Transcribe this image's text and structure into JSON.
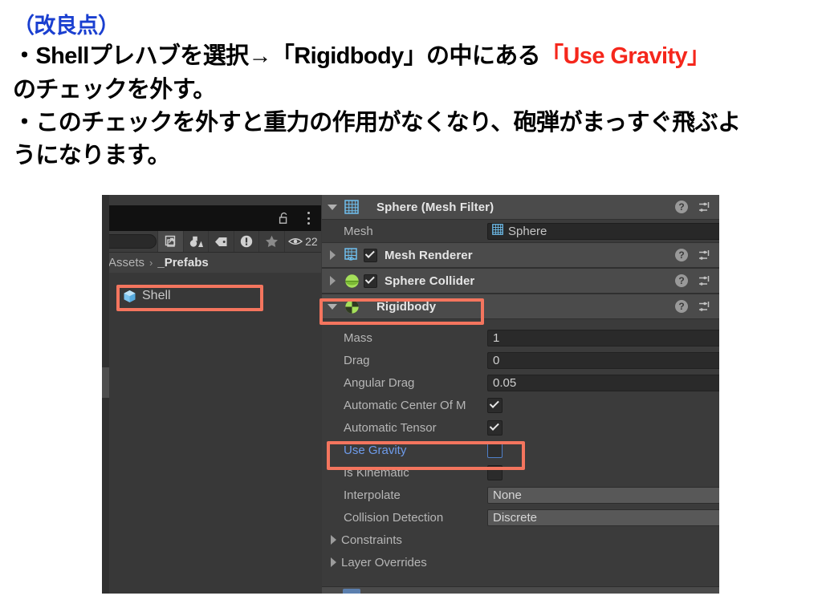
{
  "slide": {
    "heading": "（改良点）",
    "lines": [
      "・Shellプレハブを選択→「Rigidbody」の中にある",
      "のチェックを外す。",
      "・このチェックを外すと重力の作用がなくなり、砲弾がまっすぐ飛ぶよ",
      "うになります。"
    ],
    "accent_text": "「Use Gravity」",
    "heading_color": "#1a3fd0",
    "accent_color": "#f5271c",
    "body_color": "#000000"
  },
  "unity": {
    "project_panel": {
      "lock_icon": "lock-open-icon",
      "kebab_icon": "kebab-menu-icon",
      "toolbar_icons": [
        "search-field",
        "open-in-new-window-icon",
        "filter-by-type-icon",
        "filter-by-label-icon",
        "filter-by-warning-icon",
        "filter-by-favorite-icon",
        "visibility-eye-icon"
      ],
      "hidden_count": "22",
      "breadcrumb": {
        "root": "Assets",
        "separator": "›",
        "current": "_Prefabs"
      },
      "assets": [
        {
          "name": "Shell",
          "icon": "prefab-cube-icon",
          "selected": true
        }
      ]
    },
    "inspector": {
      "components": [
        {
          "title": "Sphere (Mesh Filter)",
          "icon": "mesh-filter-icon",
          "expanded": true,
          "has_enable_checkbox": false,
          "properties": [
            {
              "label": "Mesh",
              "type": "object",
              "value": "Sphere",
              "icon": "mesh-icon"
            }
          ]
        },
        {
          "title": "Mesh Renderer",
          "icon": "mesh-renderer-icon",
          "expanded": false,
          "has_enable_checkbox": true,
          "enabled": true,
          "properties": []
        },
        {
          "title": "Sphere Collider",
          "icon": "sphere-collider-icon",
          "expanded": false,
          "has_enable_checkbox": true,
          "enabled": true,
          "properties": []
        },
        {
          "title": "Rigidbody",
          "icon": "rigidbody-icon",
          "expanded": true,
          "has_enable_checkbox": false,
          "highlighted": true,
          "properties": [
            {
              "label": "Mass",
              "type": "number",
              "value": "1"
            },
            {
              "label": "Drag",
              "type": "number",
              "value": "0"
            },
            {
              "label": "Angular Drag",
              "type": "number",
              "value": "0.05"
            },
            {
              "label": "Automatic Center Of M",
              "type": "checkbox",
              "checked": true
            },
            {
              "label": "Automatic Tensor",
              "type": "checkbox",
              "checked": true
            },
            {
              "label": "Use Gravity",
              "type": "checkbox",
              "checked": false,
              "highlighted": true
            },
            {
              "label": "Is Kinematic",
              "type": "checkbox",
              "checked": false
            },
            {
              "label": "Interpolate",
              "type": "popup",
              "value": "None"
            },
            {
              "label": "Collision Detection",
              "type": "popup",
              "value": "Discrete"
            },
            {
              "label": "Constraints",
              "type": "foldout"
            },
            {
              "label": "Layer Overrides",
              "type": "foldout"
            }
          ]
        }
      ],
      "help_icon": "help-question-icon",
      "preset_icon": "preset-sliders-icon",
      "help_label": "?"
    },
    "annotation_color": "#f4755e"
  }
}
